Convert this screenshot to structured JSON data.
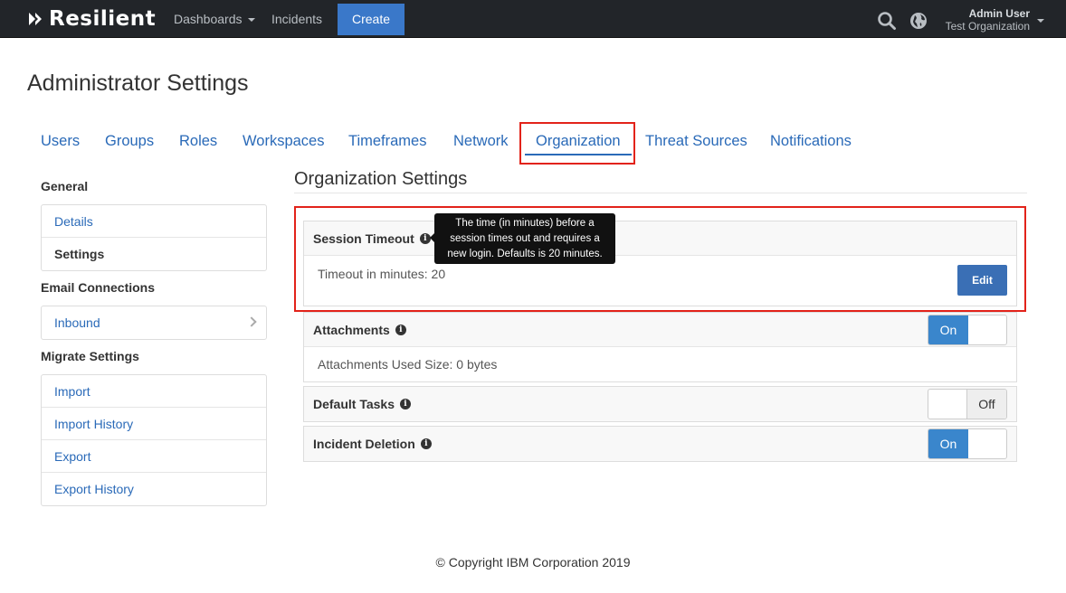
{
  "topbar": {
    "brand": "Resilient",
    "nav": {
      "dashboards": "Dashboards",
      "incidents": "Incidents",
      "create": "Create"
    },
    "user": {
      "name": "Admin User",
      "org": "Test Organization"
    }
  },
  "page": {
    "title": "Administrator Settings"
  },
  "tabs": [
    {
      "label": "Users"
    },
    {
      "label": "Groups"
    },
    {
      "label": "Roles"
    },
    {
      "label": "Workspaces"
    },
    {
      "label": "Timeframes"
    },
    {
      "label": "Network"
    },
    {
      "label": "Organization",
      "active": true
    },
    {
      "label": "Threat Sources"
    },
    {
      "label": "Notifications"
    }
  ],
  "sidebar": {
    "general": {
      "heading": "General",
      "items": [
        {
          "label": "Details"
        },
        {
          "label": "Settings",
          "selected": true
        }
      ]
    },
    "email": {
      "heading": "Email Connections",
      "items": [
        {
          "label": "Inbound"
        }
      ]
    },
    "migrate": {
      "heading": "Migrate Settings",
      "items": [
        {
          "label": "Import"
        },
        {
          "label": "Import History"
        },
        {
          "label": "Export"
        },
        {
          "label": "Export History"
        }
      ]
    }
  },
  "main": {
    "title": "Organization Settings",
    "session": {
      "label": "Session Timeout",
      "body": "Timeout in minutes: 20",
      "edit": "Edit",
      "tooltip": [
        "The time (in minutes) before a",
        "session times out and requires a",
        "new login. Defaults is 20 minutes."
      ]
    },
    "attachments": {
      "label": "Attachments",
      "body": "Attachments Used Size: 0 bytes",
      "toggle": "On",
      "state": "on"
    },
    "default_tasks": {
      "label": "Default Tasks",
      "toggle": "Off",
      "state": "off"
    },
    "incident_deletion": {
      "label": "Incident Deletion",
      "toggle": "On",
      "state": "on"
    }
  },
  "footer": {
    "text": "© Copyright IBM Corporation 2019"
  },
  "colors": {
    "accent": "#3a78c9",
    "link": "#2a6ab8",
    "highlight": "#e2231a",
    "topbar": "#222529"
  }
}
